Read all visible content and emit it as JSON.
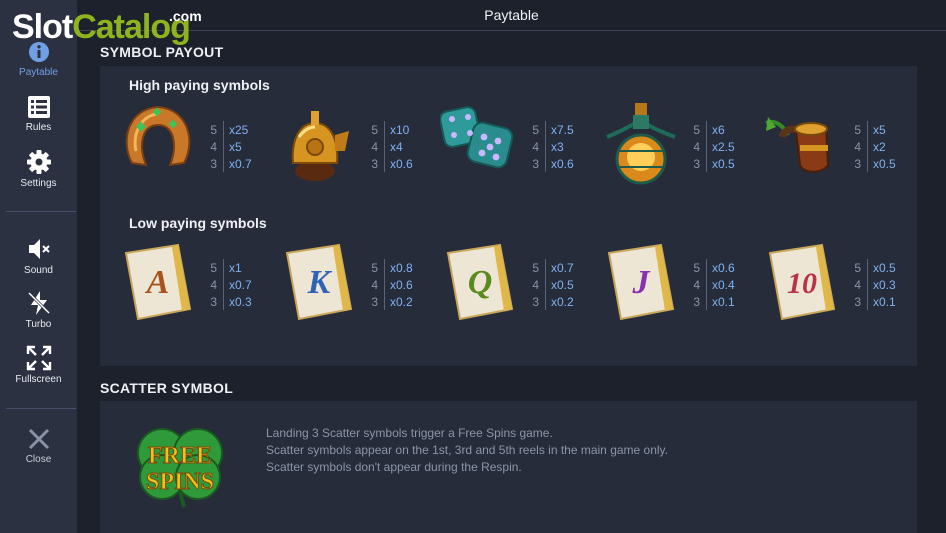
{
  "watermark": {
    "slot": "Slot",
    "catalog": "Catalog",
    "com": ".com"
  },
  "sidebar": {
    "items": [
      {
        "label": "Paytable",
        "icon": "info-icon",
        "active": true
      },
      {
        "label": "Rules",
        "icon": "list-icon"
      },
      {
        "label": "Settings",
        "icon": "gear-icon"
      },
      {
        "label": "Sound",
        "icon": "speaker-muted-icon"
      },
      {
        "label": "Turbo",
        "icon": "lightning-icon"
      },
      {
        "label": "Fullscreen",
        "icon": "expand-icon"
      },
      {
        "label": "Close",
        "icon": "close-icon"
      }
    ]
  },
  "header": {
    "title": "Paytable"
  },
  "payout": {
    "title": "SYMBOL PAYOUT",
    "high": {
      "title": "High paying symbols",
      "symbols": [
        {
          "icon": "horseshoe-icon",
          "pays": [
            {
              "n": "5",
              "v": "x25"
            },
            {
              "n": "4",
              "v": "x5"
            },
            {
              "n": "3",
              "v": "x0.7"
            }
          ]
        },
        {
          "icon": "golden-helmet-icon",
          "pays": [
            {
              "n": "5",
              "v": "x10"
            },
            {
              "n": "4",
              "v": "x4"
            },
            {
              "n": "3",
              "v": "x0.6"
            }
          ]
        },
        {
          "icon": "dice-icon",
          "pays": [
            {
              "n": "5",
              "v": "x7.5"
            },
            {
              "n": "4",
              "v": "x3"
            },
            {
              "n": "3",
              "v": "x0.6"
            }
          ]
        },
        {
          "icon": "potion-bottle-icon",
          "pays": [
            {
              "n": "5",
              "v": "x6"
            },
            {
              "n": "4",
              "v": "x2.5"
            },
            {
              "n": "3",
              "v": "x0.5"
            }
          ]
        },
        {
          "icon": "pipe-icon",
          "pays": [
            {
              "n": "5",
              "v": "x5"
            },
            {
              "n": "4",
              "v": "x2"
            },
            {
              "n": "3",
              "v": "x0.5"
            }
          ]
        }
      ]
    },
    "low": {
      "title": "Low paying symbols",
      "symbols": [
        {
          "icon": "scroll-a-icon",
          "letter": "A",
          "color": "#a8521e",
          "pays": [
            {
              "n": "5",
              "v": "x1"
            },
            {
              "n": "4",
              "v": "x0.7"
            },
            {
              "n": "3",
              "v": "x0.3"
            }
          ]
        },
        {
          "icon": "scroll-k-icon",
          "letter": "K",
          "color": "#2f63b8",
          "pays": [
            {
              "n": "5",
              "v": "x0.8"
            },
            {
              "n": "4",
              "v": "x0.6"
            },
            {
              "n": "3",
              "v": "x0.2"
            }
          ]
        },
        {
          "icon": "scroll-q-icon",
          "letter": "Q",
          "color": "#5a8a1e",
          "pays": [
            {
              "n": "5",
              "v": "x0.7"
            },
            {
              "n": "4",
              "v": "x0.5"
            },
            {
              "n": "3",
              "v": "x0.2"
            }
          ]
        },
        {
          "icon": "scroll-j-icon",
          "letter": "J",
          "color": "#8a2fb0",
          "pays": [
            {
              "n": "5",
              "v": "x0.6"
            },
            {
              "n": "4",
              "v": "x0.4"
            },
            {
              "n": "3",
              "v": "x0.1"
            }
          ]
        },
        {
          "icon": "scroll-10-icon",
          "letter": "10",
          "color": "#b8324a",
          "pays": [
            {
              "n": "5",
              "v": "x0.5"
            },
            {
              "n": "4",
              "v": "x0.3"
            },
            {
              "n": "3",
              "v": "x0.1"
            }
          ]
        }
      ]
    }
  },
  "scatter": {
    "title": "SCATTER SYMBOL",
    "icon": "free-spins-clover-icon",
    "logo_text": [
      "FREE",
      "SPINS"
    ],
    "lines": [
      "Landing 3 Scatter symbols trigger a Free Spins game.",
      "Scatter symbols appear on the 1st, 3rd and 5th reels in the main game only.",
      "Scatter symbols don't appear during the Respin."
    ]
  }
}
